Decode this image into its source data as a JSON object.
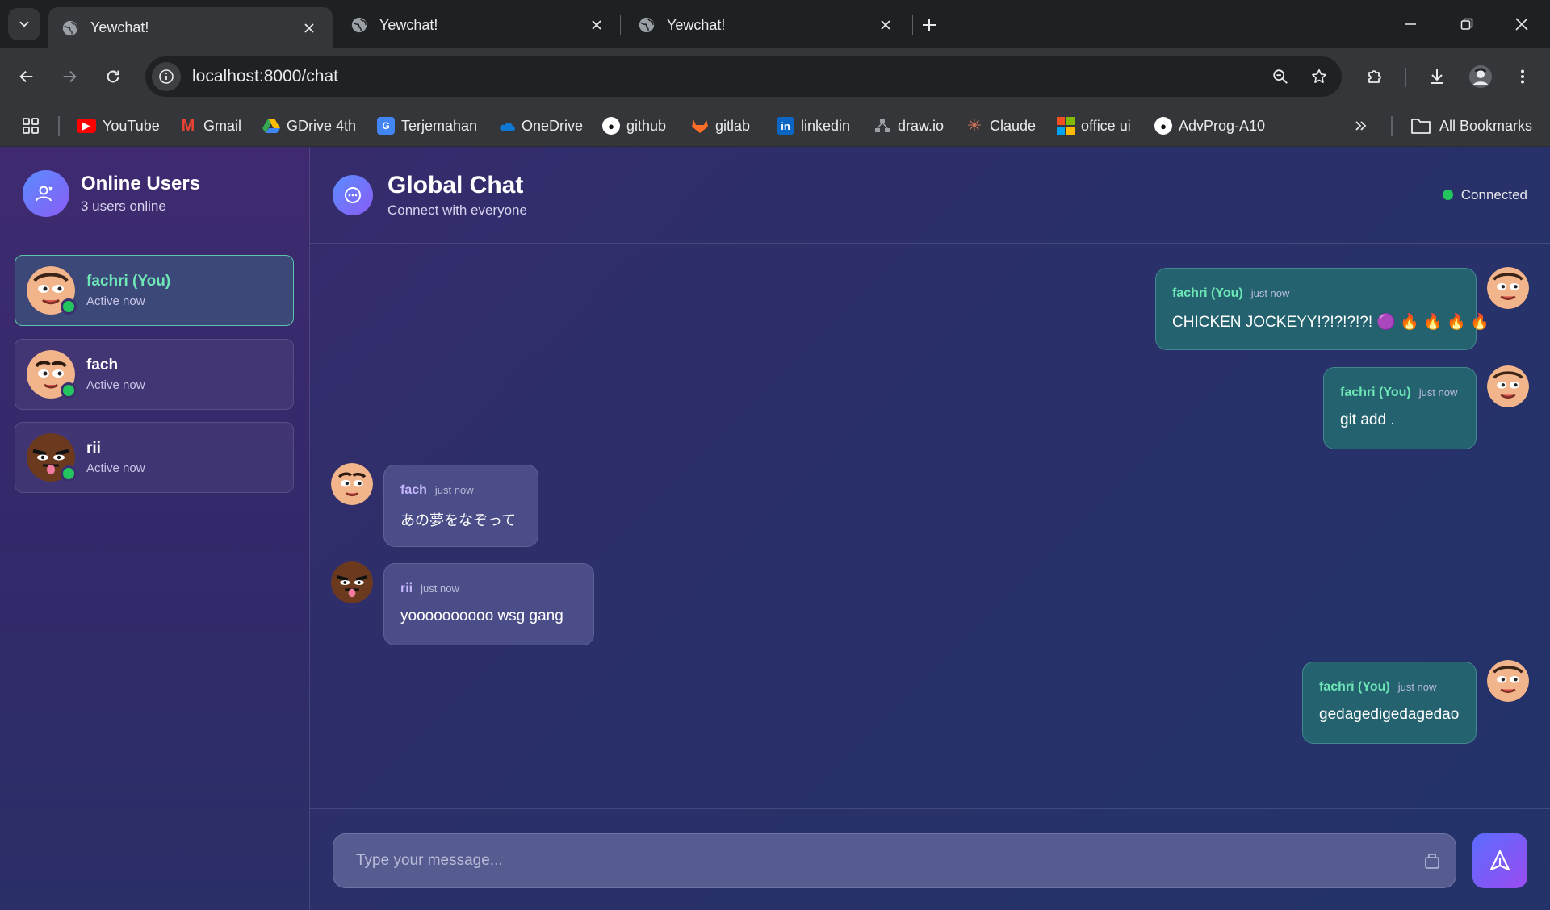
{
  "browser": {
    "tabs": [
      {
        "title": "Yewchat!",
        "active": true
      },
      {
        "title": "Yewchat!",
        "active": false
      },
      {
        "title": "Yewchat!",
        "active": false
      }
    ],
    "url": "localhost:8000/chat",
    "bookmarks": [
      {
        "label": "YouTube",
        "icon": "youtube-icon",
        "color": "#ff0000"
      },
      {
        "label": "Gmail",
        "icon": "gmail-icon",
        "color": "#ea4335"
      },
      {
        "label": "GDrive 4th",
        "icon": "gdrive-icon",
        "color": "#34a853"
      },
      {
        "label": "Terjemahan",
        "icon": "translate-icon",
        "color": "#4285f4"
      },
      {
        "label": "OneDrive",
        "icon": "onedrive-icon",
        "color": "#0f78d4"
      },
      {
        "label": "github",
        "icon": "github-icon",
        "color": "#ffffff"
      },
      {
        "label": "gitlab",
        "icon": "gitlab-icon",
        "color": "#fc6d26"
      },
      {
        "label": "linkedin",
        "icon": "linkedin-icon",
        "color": "#0a66c2"
      },
      {
        "label": "draw.io",
        "icon": "drawio-icon",
        "color": "#9aa0a6"
      },
      {
        "label": "Claude",
        "icon": "claude-icon",
        "color": "#d97757"
      },
      {
        "label": "office ui",
        "icon": "office-icon",
        "color": "#f25022"
      },
      {
        "label": "AdvProg-A10",
        "icon": "github-icon",
        "color": "#ffffff"
      }
    ],
    "all_bookmarks": "All Bookmarks"
  },
  "sidebar": {
    "title": "Online Users",
    "subtitle": "3 users online",
    "users": [
      {
        "name": "fachri (You)",
        "status": "Active now",
        "is_me": true
      },
      {
        "name": "fach",
        "status": "Active now",
        "is_me": false
      },
      {
        "name": "rii",
        "status": "Active now",
        "is_me": false
      }
    ]
  },
  "chat": {
    "title": "Global Chat",
    "subtitle": "Connect with everyone",
    "connection_status": "Connected",
    "messages": [
      {
        "sender": "fachri (You)",
        "time": "just now",
        "text": "CHICKEN JOCKEYY!?!?!?!?! 🟣 🔥 🔥 🔥 🔥",
        "mine": true
      },
      {
        "sender": "fachri (You)",
        "time": "just now",
        "text": "git add .",
        "mine": true
      },
      {
        "sender": "fach",
        "time": "just now",
        "text": "あの夢をなぞって",
        "mine": false
      },
      {
        "sender": "rii",
        "time": "just now",
        "text": "yoooooooooo wsg gang",
        "mine": false
      },
      {
        "sender": "fachri (You)",
        "time": "just now",
        "text": "gedagedigedagedao",
        "mine": true
      }
    ],
    "input_placeholder": "Type your message..."
  },
  "colors": {
    "accent_green": "#6ee7b7",
    "accent_purple": "#c4b5fd",
    "online": "#22c55e",
    "send_gradient_start": "#5b6cff",
    "send_gradient_end": "#9b4cf0"
  }
}
